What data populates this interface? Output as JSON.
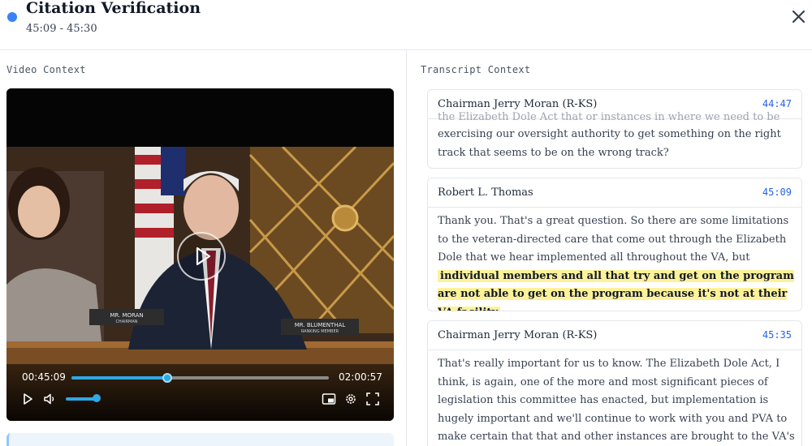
{
  "header": {
    "title": "Citation Verification",
    "time_range": "45:09 - 45:30",
    "accent_color": "#3b82f6"
  },
  "video": {
    "section_label": "Video Context",
    "current_time": "00:45:09",
    "duration": "02:00:57",
    "progress_fraction": 0.373,
    "volume_fraction": 0.85,
    "nameplates": {
      "left_name": "MR. MORAN",
      "left_role": "CHAIRMAN",
      "right_name": "MR. BLUMENTHAL",
      "right_role": "RANKING MEMBER"
    }
  },
  "transcript": {
    "section_label": "Transcript Context",
    "entries": [
      {
        "speaker": "Chairman Jerry Moran (R-KS)",
        "timestamp": "44:47",
        "cut_line": "the Elizabeth Dole Act that or instances in where we need to be",
        "text": "exercising our oversight authority to get something on the right track that seems to be on the wrong track?"
      },
      {
        "speaker": "Robert L. Thomas",
        "timestamp": "45:09",
        "text_before": "Thank you. That's a great question. So there are some limitations to the veteran-directed care that come out through the Elizabeth Dole that we hear implemented all throughout the VA, but ",
        "highlight": "individual members and all that try and get on the program are not able to get on the program because it's not at their VA facility",
        "text_after": "."
      },
      {
        "speaker": "Chairman Jerry Moran (R-KS)",
        "timestamp": "45:35",
        "text": "That's really important for us to know. The Elizabeth Dole Act, I think, is again, one of the more and most significant pieces of legislation this committee has enacted, but implementation is hugely important and we'll continue to work with you and PVA to make certain that that and other instances are brought to the VA's attention for correction."
      }
    ]
  }
}
